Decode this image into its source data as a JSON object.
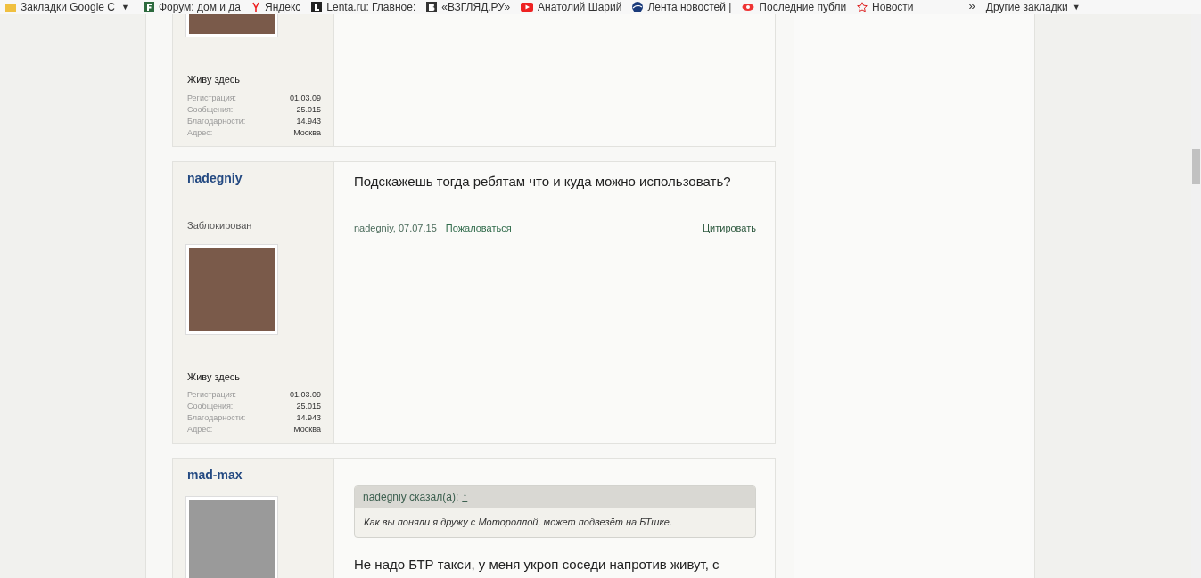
{
  "bookmarks": [
    {
      "label": "Закладки Google С",
      "caret": "▼"
    },
    {
      "label": "Форум: дом и да"
    },
    {
      "label": "Яндекс"
    },
    {
      "label": "Lenta.ru: Главное:"
    },
    {
      "label": "«ВЗГЛЯД.РУ»"
    },
    {
      "label": "Анатолий Шарий"
    },
    {
      "label": "Лента новостей |"
    },
    {
      "label": "Последние публи"
    },
    {
      "label": "Новости"
    }
  ],
  "other_bookmarks": {
    "chevron": "»",
    "label": "Другие закладки",
    "caret": "▼"
  },
  "posts": [
    {
      "location_label": "Живу здесь",
      "stats": [
        {
          "label": "Регистрация:",
          "value": "01.03.09"
        },
        {
          "label": "Сообщения:",
          "value": "25.015"
        },
        {
          "label": "Благодарности:",
          "value": "14.943"
        },
        {
          "label": "Адрес:",
          "value": "Москва"
        }
      ]
    },
    {
      "author": "nadegniy",
      "status": "Заблокирован",
      "location_label": "Живу здесь",
      "stats": [
        {
          "label": "Регистрация:",
          "value": "01.03.09"
        },
        {
          "label": "Сообщения:",
          "value": "25.015"
        },
        {
          "label": "Благодарности:",
          "value": "14.943"
        },
        {
          "label": "Адрес:",
          "value": "Москва"
        }
      ],
      "body": "Подскажешь тогда ребятам что и куда можно использовать?",
      "signature": "nadegniy, 07.07.15",
      "report": "Пожаловаться",
      "quote_link": "Цитировать"
    },
    {
      "author": "mad-max",
      "quote": {
        "header": "nadegniy сказал(а):",
        "jump": "↑",
        "text": "Как вы поняли я дружу с Мотороллой, может подвезёт на БТшке."
      },
      "body": "Не надо БТР такси, у меня укроп соседи напротив живут, с"
    }
  ]
}
